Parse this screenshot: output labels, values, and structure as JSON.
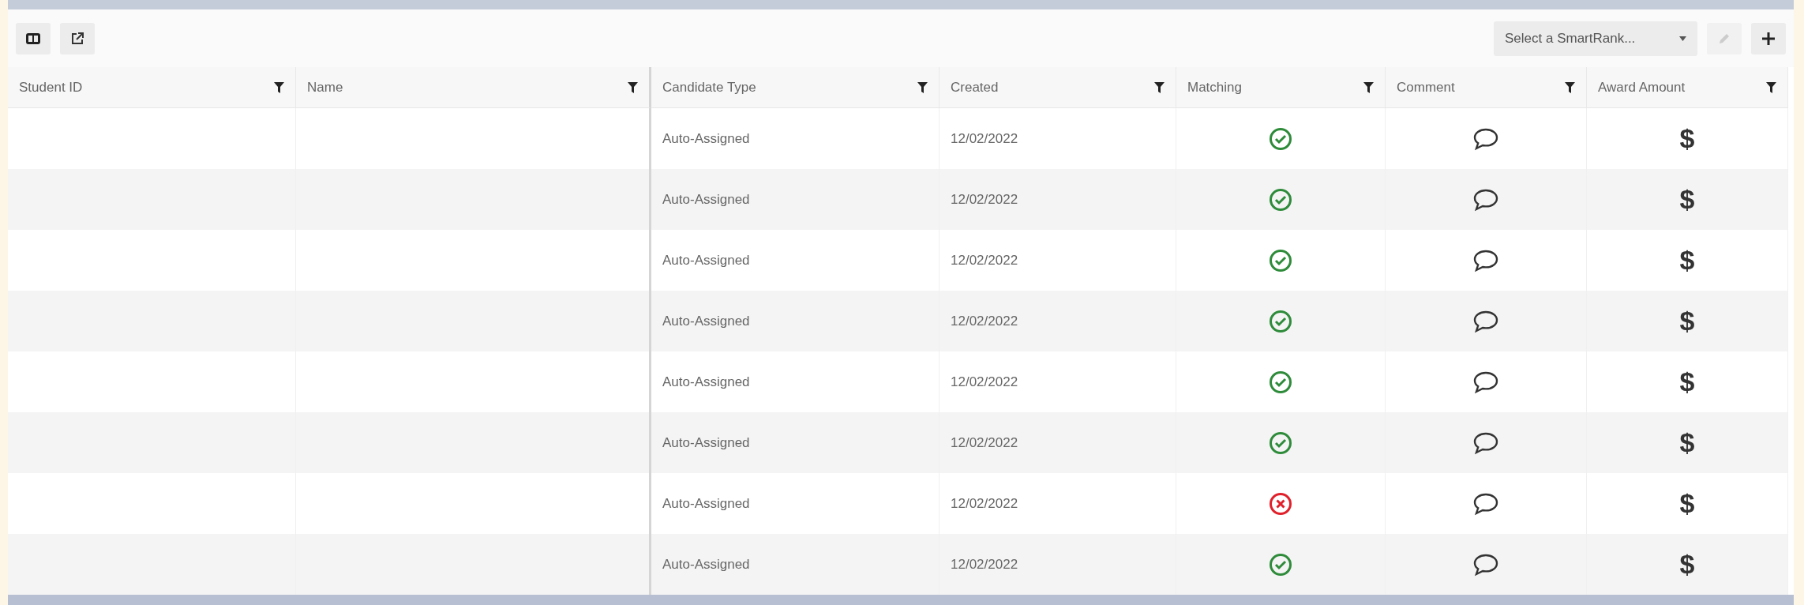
{
  "toolbar": {
    "smartrank_select": {
      "placeholder": "Select a SmartRank..."
    }
  },
  "table": {
    "columns": [
      {
        "label": "Student ID"
      },
      {
        "label": "Name"
      },
      {
        "label": "Candidate Type"
      },
      {
        "label": "Created"
      },
      {
        "label": "Matching"
      },
      {
        "label": "Comment"
      },
      {
        "label": "Award Amount"
      }
    ],
    "rows": [
      {
        "candidate_type": "Auto-Assigned",
        "created": "12/02/2022",
        "matched": true,
        "award": "$"
      },
      {
        "candidate_type": "Auto-Assigned",
        "created": "12/02/2022",
        "matched": true,
        "award": "$"
      },
      {
        "candidate_type": "Auto-Assigned",
        "created": "12/02/2022",
        "matched": true,
        "award": "$"
      },
      {
        "candidate_type": "Auto-Assigned",
        "created": "12/02/2022",
        "matched": true,
        "award": "$"
      },
      {
        "candidate_type": "Auto-Assigned",
        "created": "12/02/2022",
        "matched": true,
        "award": "$"
      },
      {
        "candidate_type": "Auto-Assigned",
        "created": "12/02/2022",
        "matched": true,
        "award": "$"
      },
      {
        "candidate_type": "Auto-Assigned",
        "created": "12/02/2022",
        "matched": false,
        "award": "$"
      },
      {
        "candidate_type": "Auto-Assigned",
        "created": "12/02/2022",
        "matched": true,
        "award": "$"
      }
    ]
  }
}
